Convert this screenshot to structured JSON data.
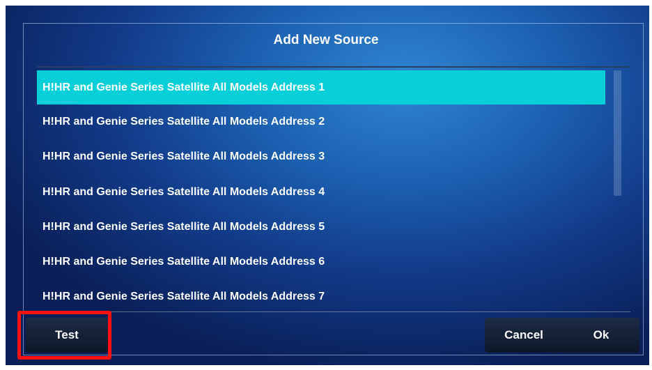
{
  "dialog": {
    "title": "Add New Source",
    "items": [
      {
        "label": "H!HR and Genie Series Satellite All Models Address 1",
        "selected": true
      },
      {
        "label": "H!HR and Genie Series Satellite All Models Address 2",
        "selected": false
      },
      {
        "label": "H!HR and Genie Series Satellite All Models Address 3",
        "selected": false
      },
      {
        "label": "H!HR and Genie Series Satellite All Models Address 4",
        "selected": false
      },
      {
        "label": "H!HR and Genie Series Satellite All Models Address 5",
        "selected": false
      },
      {
        "label": "H!HR and Genie Series Satellite All Models Address 6",
        "selected": false
      },
      {
        "label": "H!HR and Genie Series Satellite All Models Address 7",
        "selected": false
      }
    ],
    "buttons": {
      "test": "Test",
      "cancel": "Cancel",
      "ok": "Ok"
    }
  },
  "colors": {
    "selected_row": "#09d0d8",
    "highlight": "#ff1010",
    "background": "#1c5fb0"
  }
}
